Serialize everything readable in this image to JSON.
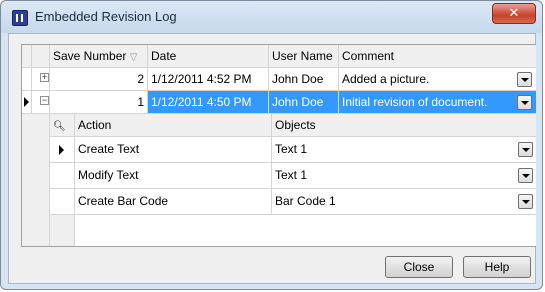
{
  "window": {
    "title": "Embedded Revision Log",
    "close_glyph": "✕",
    "icon": "app-icon"
  },
  "grid": {
    "columns": {
      "save_number": "Save Number",
      "date": "Date",
      "user_name": "User Name",
      "comment": "Comment"
    },
    "rows": [
      {
        "save_number": "2",
        "date": "1/12/2011 4:52 PM",
        "user_name": "John Doe",
        "comment": "Added a picture.",
        "expander": "+"
      },
      {
        "save_number": "1",
        "date": "1/12/2011 4:50 PM",
        "user_name": "John Doe",
        "comment": "Initial revision of document.",
        "expander": "−"
      }
    ],
    "detail": {
      "columns": {
        "action": "Action",
        "objects": "Objects"
      },
      "rows": [
        {
          "action": "Create Text",
          "objects": "Text 1"
        },
        {
          "action": "Modify Text",
          "objects": "Text 1"
        },
        {
          "action": "Create Bar Code",
          "objects": "Bar Code 1"
        }
      ]
    }
  },
  "buttons": {
    "close": "Close",
    "help": "Help"
  },
  "colors": {
    "selection": "#3399ff",
    "title_bar": "#c6d8ec",
    "close_button": "#c6422c"
  }
}
